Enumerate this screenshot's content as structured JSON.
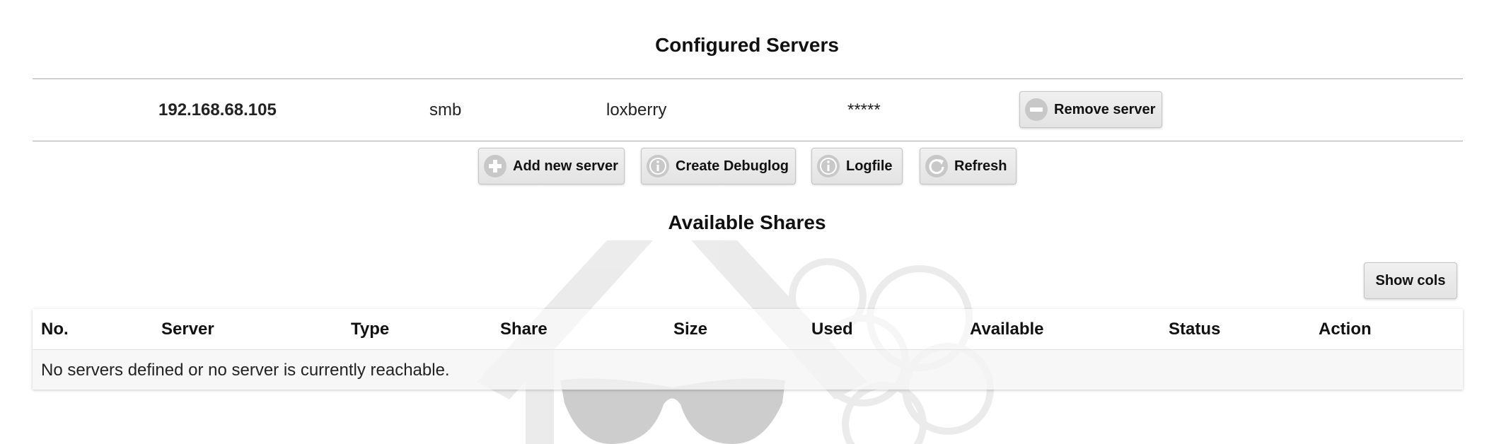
{
  "configured_servers": {
    "title": "Configured Servers",
    "servers": [
      {
        "host": "192.168.68.105",
        "type": "smb",
        "username": "loxberry",
        "password": "*****",
        "remove_label": "Remove server"
      }
    ]
  },
  "actions": {
    "add_label": "Add new server",
    "debuglog_label": "Create Debuglog",
    "logfile_label": "Logfile",
    "refresh_label": "Refresh"
  },
  "shares": {
    "title": "Available Shares",
    "show_cols_label": "Show cols",
    "columns": [
      "No.",
      "Server",
      "Type",
      "Share",
      "Size",
      "Used",
      "Available",
      "Status",
      "Action"
    ],
    "empty_message": "No servers defined or no server is currently reachable."
  },
  "icons": {
    "remove": "minus-circle-icon",
    "add": "plus-circle-icon",
    "info": "info-circle-icon",
    "refresh": "refresh-icon",
    "watermark": "loxberry-logo"
  },
  "colors": {
    "button_bg": "#e8e8e8",
    "icon_circle": "#c8c8c8",
    "rule": "#a8a8a8"
  }
}
